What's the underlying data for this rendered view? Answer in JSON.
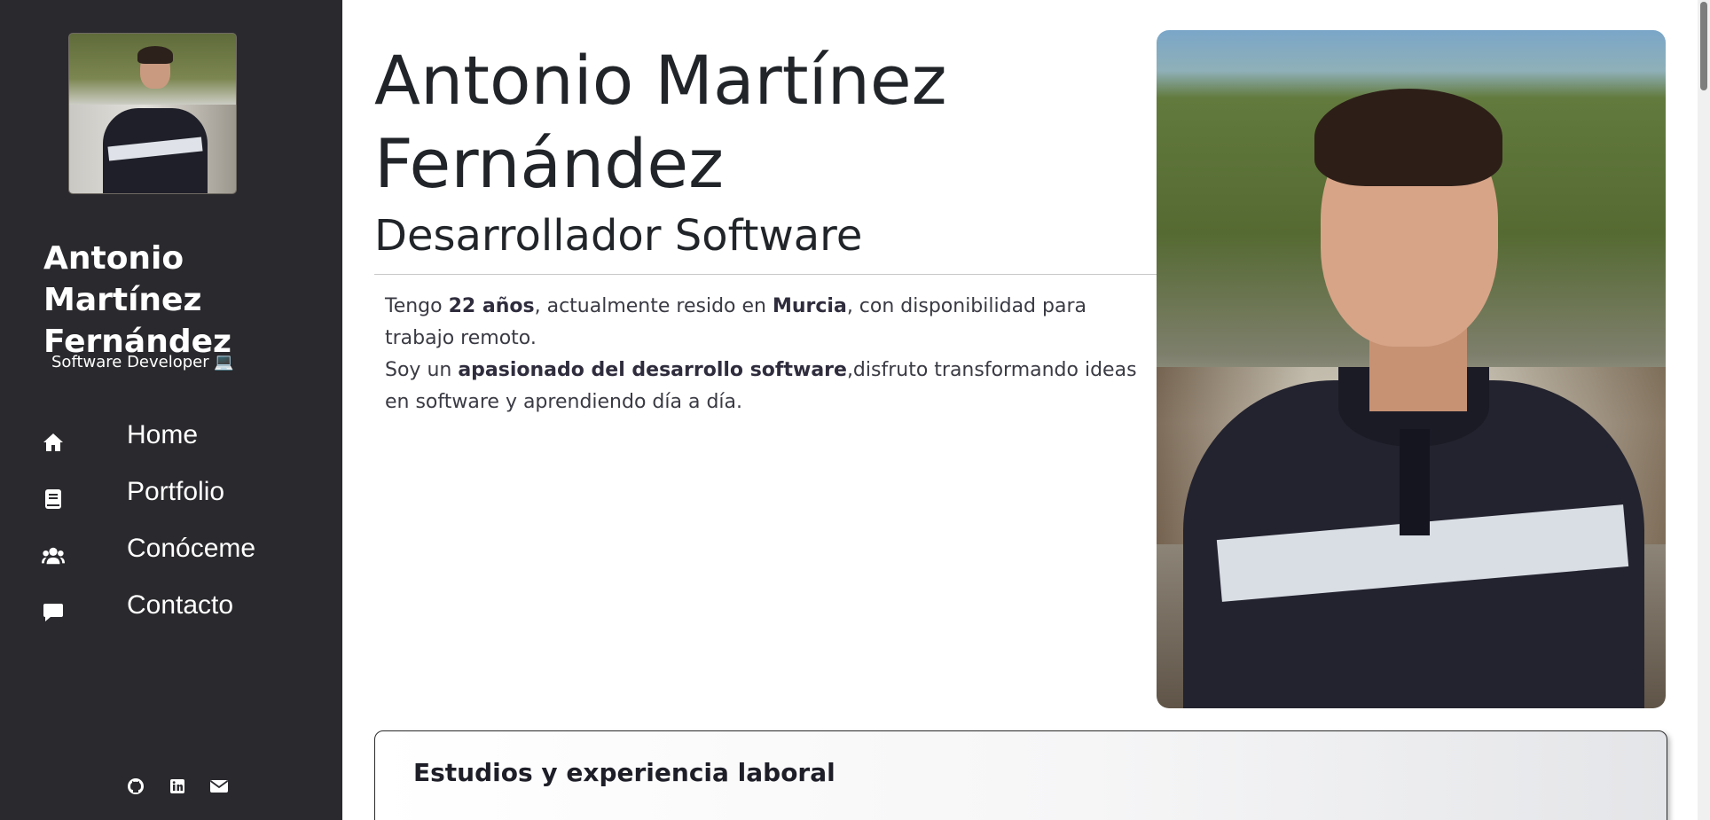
{
  "sidebar": {
    "name": "Antonio Martínez Fernández",
    "role": "Software Developer 💻",
    "nav": [
      {
        "label": "Home",
        "icon": "home-icon"
      },
      {
        "label": "Portfolio",
        "icon": "book-icon"
      },
      {
        "label": "Conóceme",
        "icon": "users-icon"
      },
      {
        "label": "Contacto",
        "icon": "chat-icon"
      }
    ],
    "socials": [
      "github-icon",
      "linkedin-icon",
      "envelope-icon"
    ]
  },
  "main": {
    "title": "Antonio Martínez Fernández",
    "subtitle": "Desarrollador Software",
    "bio": {
      "p1_a": "Tengo ",
      "p1_b": "22 años",
      "p1_c": ", actualmente resido en ",
      "p1_d": "Murcia",
      "p1_e": ", con disponibilidad para trabajo remoto.",
      "p2_a": "Soy un ",
      "p2_b": "apasionado del desarrollo software",
      "p2_c": ",disfruto transformando ideas en software y aprendiendo día a día."
    },
    "card_title": "Estudios y experiencia laboral"
  },
  "colors": {
    "sidebar_bg": "#2a292d",
    "text": "#212529"
  }
}
